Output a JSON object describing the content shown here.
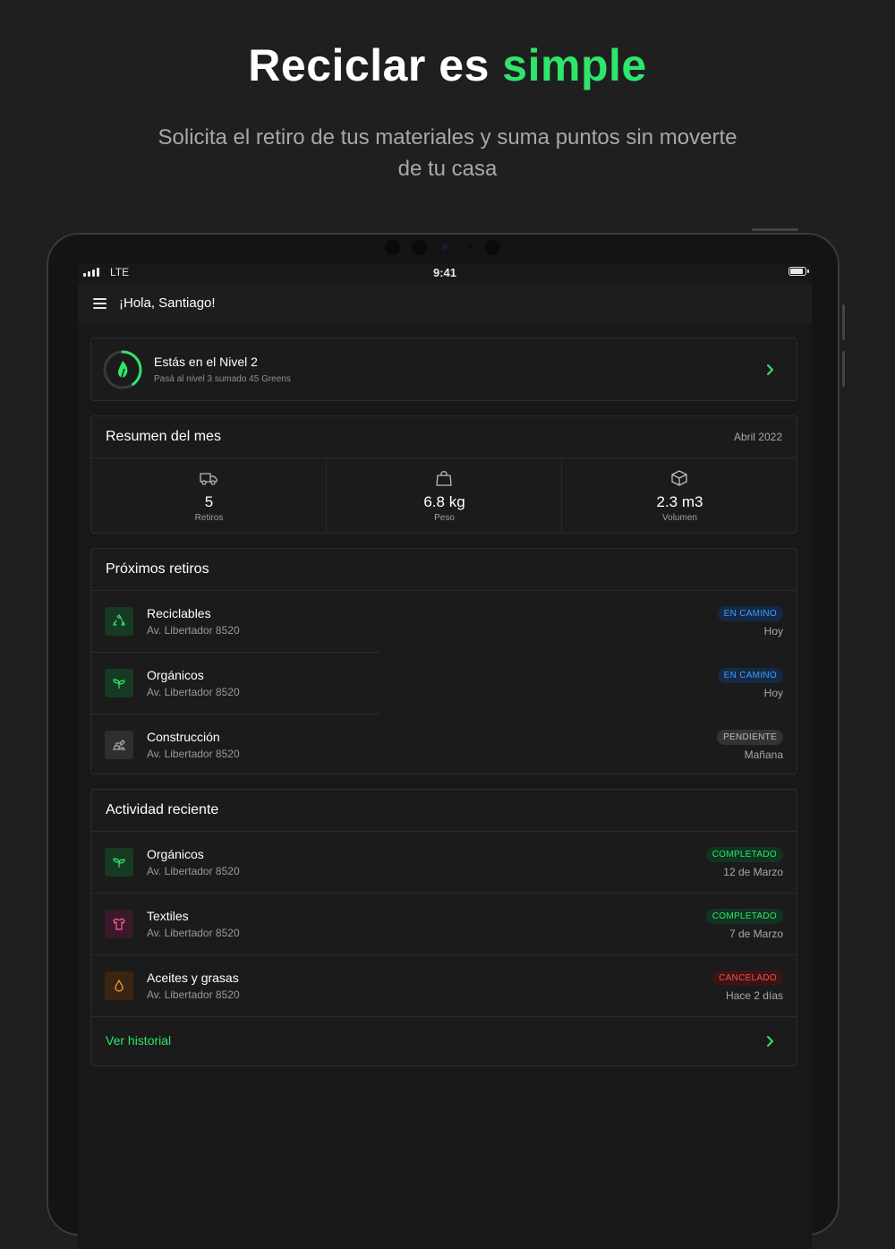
{
  "hero": {
    "title_part1": "Reciclar es",
    "title_part2": "simple",
    "subtitle": "Solicita el retiro de tus materiales y suma puntos sin moverte de tu casa"
  },
  "status_bar": {
    "carrier": "LTE",
    "time": "9:41"
  },
  "app_bar": {
    "greeting": "¡Hola, Santiago!"
  },
  "level": {
    "title": "Estás en el Nivel 2",
    "subtitle": "Pasá al nivel 3 sumado 45 Greens",
    "progress": 0.4
  },
  "summary": {
    "title": "Resumen del mes",
    "period": "Abril 2022",
    "stats": [
      {
        "value": "5",
        "label": "Retiros",
        "icon": "truck-icon"
      },
      {
        "value": "6.8 kg",
        "label": "Peso",
        "icon": "bag-icon"
      },
      {
        "value": "2.3 m3",
        "label": "Volumen",
        "icon": "box-icon"
      }
    ]
  },
  "upcoming": {
    "title": "Próximos retiros",
    "items": [
      {
        "title": "Reciclables",
        "address": "Av. Libertador 8520",
        "status": "EN CAMINO",
        "when": "Hoy",
        "icon": "recycle-icon"
      },
      {
        "title": "Orgánicos",
        "address": "Av. Libertador 8520",
        "status": "EN CAMINO",
        "when": "Hoy",
        "icon": "sprout-icon"
      },
      {
        "title": "Construcción",
        "address": "Av. Libertador 8520",
        "status": "PENDIENTE",
        "when": "Mañana",
        "icon": "bricks-icon"
      }
    ]
  },
  "recent": {
    "title": "Actividad reciente",
    "items": [
      {
        "title": "Orgánicos",
        "address": "Av. Libertador 8520",
        "status": "COMPLETADO",
        "when": "12 de Marzo",
        "icon": "sprout-icon"
      },
      {
        "title": "Textiles",
        "address": "Av. Libertador 8520",
        "status": "COMPLETADO",
        "when": "7 de Marzo",
        "icon": "shirt-icon"
      },
      {
        "title": "Aceites y grasas",
        "address": "Av. Libertador 8520",
        "status": "CANCELADO",
        "when": "Hace 2 días",
        "icon": "drop-icon"
      }
    ],
    "history_link": "Ver historial"
  },
  "colors": {
    "accent": "#2ee66b",
    "background": "#1f1f1f",
    "card": "#1b1b1b",
    "status_blue": "#3d9bff",
    "status_red": "#ff4b4b"
  }
}
